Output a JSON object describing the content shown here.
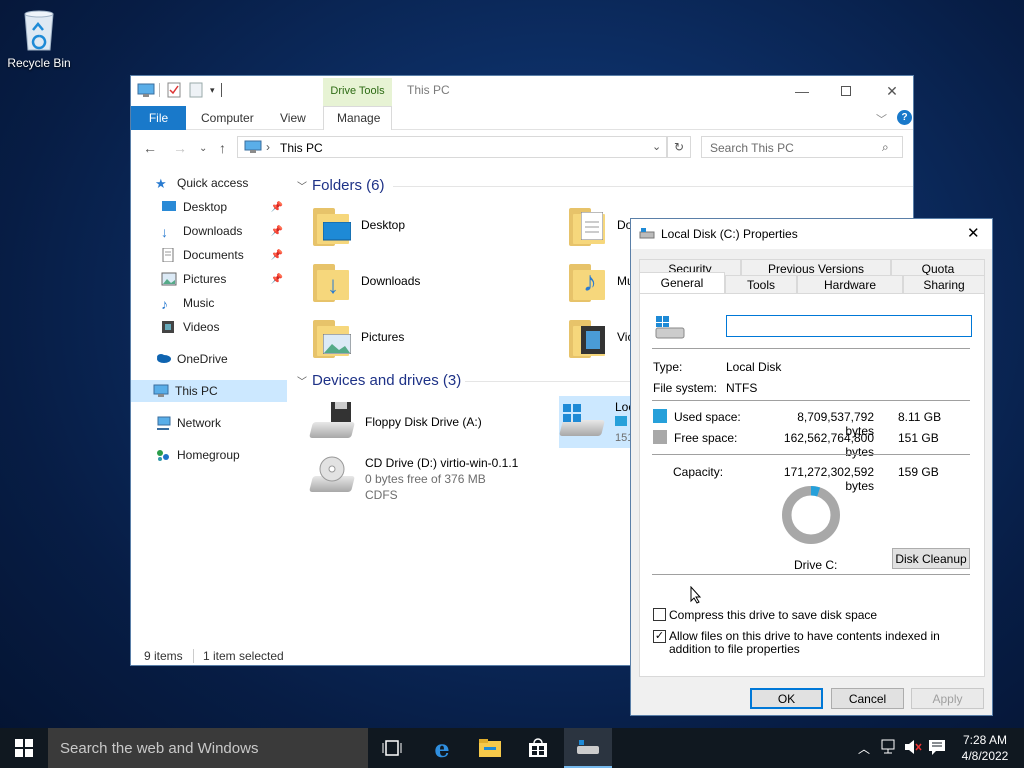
{
  "desktop": {
    "recycle_bin_label": "Recycle Bin"
  },
  "explorer": {
    "title": "This PC",
    "contextual_tab": "Drive Tools",
    "ribbon_tabs": [
      "File",
      "Computer",
      "View",
      "Manage"
    ],
    "address": "This PC",
    "search_placeholder": "Search This PC",
    "nav": {
      "quick_access": "Quick access",
      "items": [
        {
          "label": "Desktop",
          "pinned": true,
          "icon": "desktop-icon"
        },
        {
          "label": "Downloads",
          "pinned": true,
          "icon": "downloads-icon"
        },
        {
          "label": "Documents",
          "pinned": true,
          "icon": "documents-icon"
        },
        {
          "label": "Pictures",
          "pinned": true,
          "icon": "pictures-icon"
        },
        {
          "label": "Music",
          "pinned": false,
          "icon": "music-icon"
        },
        {
          "label": "Videos",
          "pinned": false,
          "icon": "videos-icon"
        }
      ],
      "onedrive": "OneDrive",
      "this_pc": "This PC",
      "network": "Network",
      "homegroup": "Homegroup"
    },
    "folders_header": "Folders (6)",
    "folders": [
      {
        "label": "Desktop"
      },
      {
        "label": "Do"
      },
      {
        "label": "Downloads"
      },
      {
        "label": "Mu"
      },
      {
        "label": "Pictures"
      },
      {
        "label": "Vic"
      }
    ],
    "devices_header": "Devices and drives (3)",
    "drives": {
      "floppy": {
        "label": "Floppy Disk Drive (A:)"
      },
      "local": {
        "label": "Loc",
        "sub": "151"
      },
      "cd": {
        "label": "CD Drive (D:) virtio-win-0.1.1",
        "free": "0 bytes free of 376 MB",
        "fs": "CDFS"
      }
    },
    "status": {
      "items": "9 items",
      "selected": "1 item selected"
    }
  },
  "properties": {
    "title": "Local Disk (C:) Properties",
    "tabs_back": [
      "Security",
      "Previous Versions",
      "Quota"
    ],
    "tabs_front": [
      "General",
      "Tools",
      "Hardware",
      "Sharing"
    ],
    "name_value": "",
    "type_label": "Type:",
    "type_value": "Local Disk",
    "fs_label": "File system:",
    "fs_value": "NTFS",
    "used_label": "Used space:",
    "used_bytes": "8,709,537,792 bytes",
    "used_size": "8.11 GB",
    "free_label": "Free space:",
    "free_bytes": "162,562,764,800 bytes",
    "free_size": "151 GB",
    "cap_label": "Capacity:",
    "cap_bytes": "171,272,302,592 bytes",
    "cap_size": "159 GB",
    "used_fraction": 0.0509,
    "drive_label": "Drive C:",
    "cleanup_button": "Disk Cleanup",
    "compress_label": "Compress this drive to save disk space",
    "compress_checked": false,
    "index_label": "Allow files on this drive to have contents indexed in addition to file properties",
    "index_checked": true,
    "ok": "OK",
    "cancel": "Cancel",
    "apply": "Apply",
    "colors": {
      "used": "#26a0da",
      "free": "#a8a8a8"
    }
  },
  "taskbar": {
    "search_placeholder": "Search the web and Windows",
    "time": "7:28 AM",
    "date": "4/8/2022"
  }
}
